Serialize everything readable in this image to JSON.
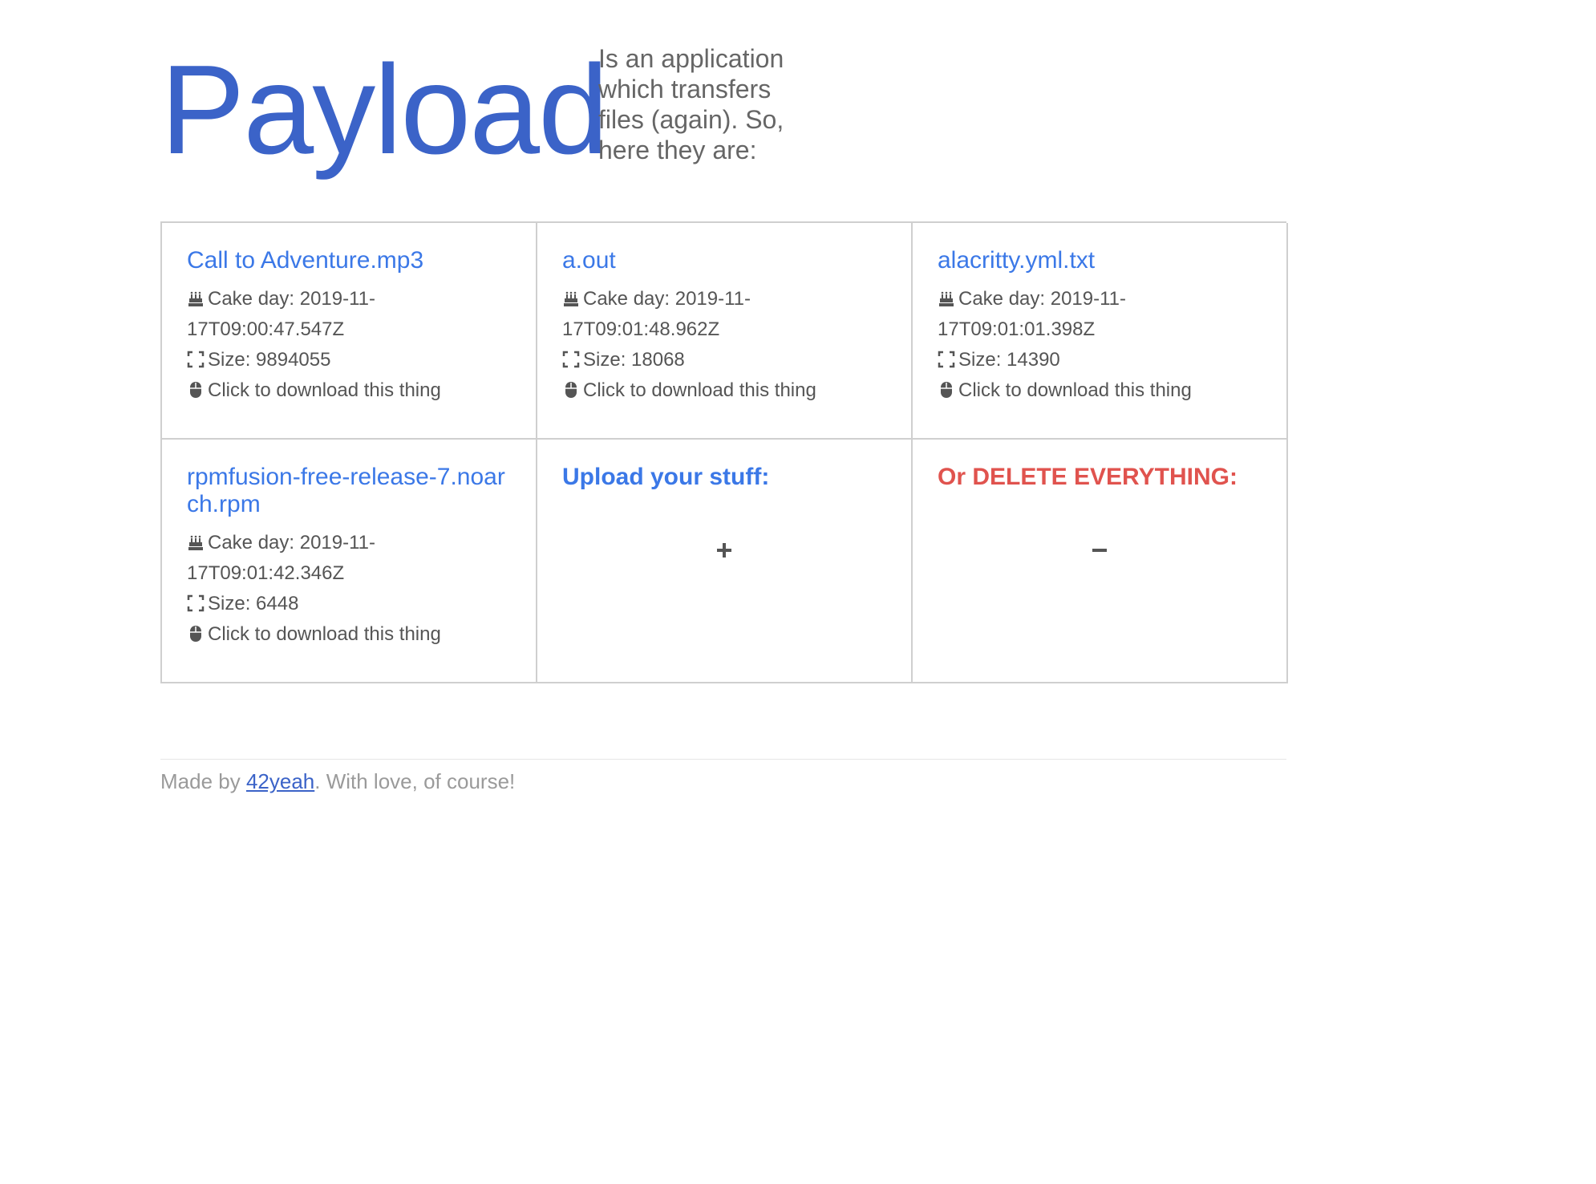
{
  "header": {
    "brand": "Payload",
    "tagline": "Is an application which transfers files (again). So, here they are:"
  },
  "files": [
    {
      "name": "Call to Adventure.mp3",
      "cake_label": "Cake day: 2019-11-17T09:00:47.547Z",
      "size_label": "Size: 9894055",
      "download_label": "Click to download this thing"
    },
    {
      "name": "a.out",
      "cake_label": "Cake day: 2019-11-17T09:01:48.962Z",
      "size_label": "Size: 18068",
      "download_label": "Click to download this thing"
    },
    {
      "name": "alacritty.yml.txt",
      "cake_label": "Cake day: 2019-11-17T09:01:01.398Z",
      "size_label": "Size: 14390",
      "download_label": "Click to download this thing"
    },
    {
      "name": "rpmfusion-free-release-7.noarch.rpm",
      "cake_label": "Cake day: 2019-11-17T09:01:42.346Z",
      "size_label": "Size: 6448",
      "download_label": "Click to download this thing"
    }
  ],
  "actions": {
    "upload_title": "Upload your stuff:",
    "delete_title": "Or DELETE EVERYTHING:"
  },
  "footer": {
    "prefix": "Made by ",
    "author": "42yeah",
    "suffix": ". With love, of course!"
  },
  "icons": {
    "cake": "birthday-cake-icon",
    "size": "expand-icon",
    "download": "mouse-icon",
    "upload": "plus-icon",
    "delete": "minus-icon"
  },
  "colors": {
    "brand": "#3b63c8",
    "link": "#3b78e7",
    "danger": "#e0534e",
    "text": "#555555",
    "muted": "#9a9a9a",
    "border": "#cfcfcf"
  }
}
